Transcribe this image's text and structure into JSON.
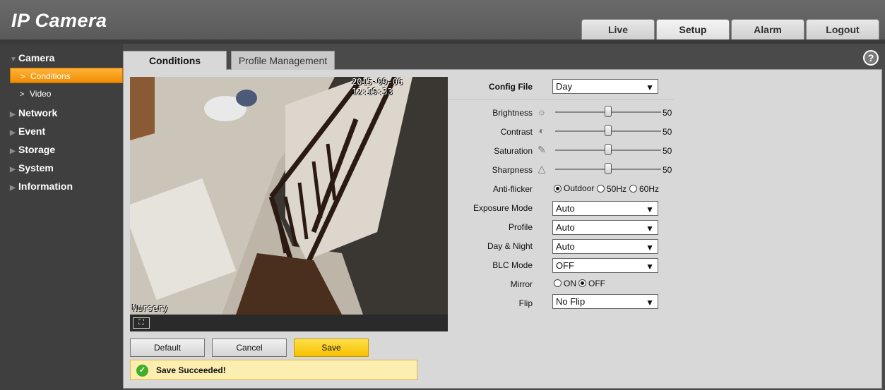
{
  "header": {
    "logo": "IP Camera",
    "nav": [
      {
        "label": "Live"
      },
      {
        "label": "Setup"
      },
      {
        "label": "Alarm"
      },
      {
        "label": "Logout"
      }
    ]
  },
  "sidebar": {
    "camera": "Camera",
    "conditions": "Conditions",
    "video": "Video",
    "network": "Network",
    "event": "Event",
    "storage": "Storage",
    "system": "System",
    "information": "Information"
  },
  "tabs": {
    "conditions": "Conditions",
    "profile_management": "Profile Management"
  },
  "help": "?",
  "video": {
    "timestamp": "2015-09-06 12:19:33",
    "camera_name": "Nursery"
  },
  "buttons": {
    "default": "Default",
    "cancel": "Cancel",
    "save": "Save"
  },
  "status": {
    "message": "Save Succeeded!"
  },
  "form": {
    "config_file_label": "Config File",
    "config_file_value": "Day",
    "brightness_label": "Brightness",
    "brightness_value": "50",
    "brightness_level": 50,
    "contrast_label": "Contrast",
    "contrast_value": "50",
    "contrast_level": 50,
    "saturation_label": "Saturation",
    "saturation_value": "50",
    "saturation_level": 50,
    "sharpness_label": "Sharpness",
    "sharpness_value": "50",
    "sharpness_level": 50,
    "antiflicker_label": "Anti-flicker",
    "antiflicker_options": [
      "Outdoor",
      "50Hz",
      "60Hz"
    ],
    "antiflicker_selected": "Outdoor",
    "exposure_label": "Exposure Mode",
    "exposure_value": "Auto",
    "profile_label": "Profile",
    "profile_value": "Auto",
    "daynight_label": "Day & Night",
    "daynight_value": "Auto",
    "blc_label": "BLC Mode",
    "blc_value": "OFF",
    "mirror_label": "Mirror",
    "mirror_options": [
      "ON",
      "OFF"
    ],
    "mirror_selected": "OFF",
    "flip_label": "Flip",
    "flip_value": "No Flip"
  }
}
